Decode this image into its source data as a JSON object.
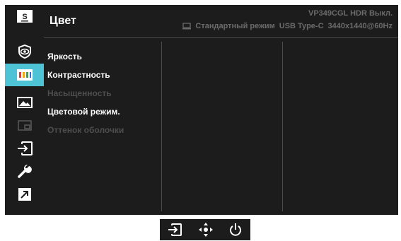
{
  "header": {
    "title": "Цвет",
    "model": "VP349CGL HDR Выкл.",
    "mode": "Стандартный режим",
    "input": "USB Type-C",
    "resolution": "3440x1440@60Hz"
  },
  "sidebar": {
    "items": [
      {
        "icon": "splendid-icon",
        "label": "S"
      },
      {
        "icon": "eye-care-icon"
      },
      {
        "icon": "color-icon",
        "active": true
      },
      {
        "icon": "image-icon"
      },
      {
        "icon": "pip-icon"
      },
      {
        "icon": "input-select-icon"
      },
      {
        "icon": "system-setup-icon"
      },
      {
        "icon": "shortcut-icon"
      }
    ]
  },
  "menu": {
    "items": [
      {
        "label": "Яркость",
        "enabled": true
      },
      {
        "label": "Контрастность",
        "enabled": true
      },
      {
        "label": "Насыщенность",
        "enabled": false
      },
      {
        "label": "Цветовой режим.",
        "enabled": true
      },
      {
        "label": "Оттенок оболочки",
        "enabled": false
      }
    ]
  },
  "colors": {
    "accent": "#4fc3d6",
    "background": "#1c1c1c",
    "text": "#ffffff",
    "disabled_text": "#4e4e4e",
    "header_info": "#6b6b6b"
  },
  "bottom_bar": {
    "icons": [
      "input-icon",
      "five-way-navigation-icon",
      "power-icon"
    ]
  }
}
